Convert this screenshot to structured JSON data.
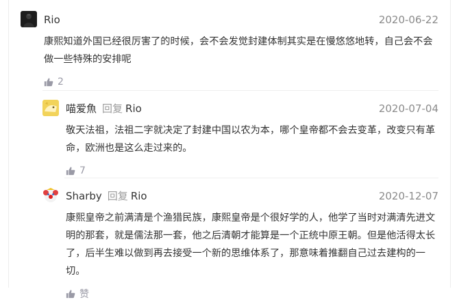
{
  "reply_word": "回复",
  "comments": [
    {
      "author": "Rio",
      "date": "2020-06-22",
      "text": "康熙知道外国已经很厉害了的时候，会不会发觉封建体制其实是在慢悠悠地转，自己会不会做一些特殊的安排呢",
      "likes": "2",
      "avatar_icon": "dark-figure-avatar"
    },
    {
      "author": "喵爱魚",
      "reply_to": "Rio",
      "date": "2020-07-04",
      "text": "敬天法祖，法祖二字就决定了封建中国以农为本，哪个皇帝都不会去变革，改变只有革命，欧洲也是这么走过来的。",
      "likes": "7",
      "avatar_icon": "yellow-cat-avatar"
    },
    {
      "author": "Sharby",
      "reply_to": "Rio",
      "date": "2020-12-07",
      "text": "康熙皇帝之前满清是个渔猎民族，康熙皇帝是个很好学的人，他学了当时对满清先进文明的那套，就是儒法那一套，他之后清朝才能算是一个正统中原王朝。但是他活得太长了，后半生难以做到再去接受一个新的思维体系了，那意味着推翻自己过去建构的一切。",
      "likes": "赞",
      "avatar_icon": "clown-avatar"
    }
  ],
  "colors": {
    "like_icon": "#9a9aa6",
    "date": "#8a8a8a",
    "reply_word": "#9b9b9b"
  }
}
